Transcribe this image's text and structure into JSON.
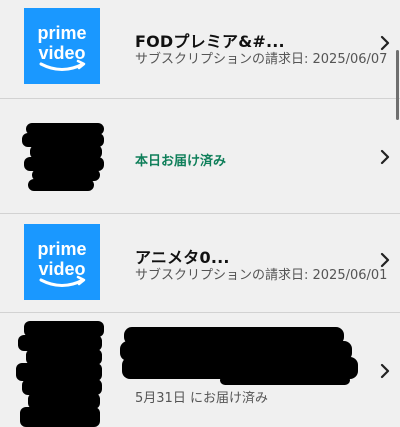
{
  "orders": [
    {
      "thumbnail": "prime-video-logo",
      "logo_line1": "prime",
      "logo_line2": "video",
      "title": "FODプレミア&#...",
      "subtitle": "サブスクリプションの請求日: 2025/06/07"
    },
    {
      "thumbnail": "redacted-image",
      "status": "本日お届け済み",
      "status_color": "#0f7f5a"
    },
    {
      "thumbnail": "prime-video-logo",
      "logo_line1": "prime",
      "logo_line2": "video",
      "title": "アニメタ0...",
      "subtitle": "サブスクリプションの請求日: 2025/06/01"
    },
    {
      "thumbnail": "redacted-image",
      "title_redacted": true,
      "status": "5月31日 にお届け済み"
    }
  ],
  "colors": {
    "background": "#f0f0f0",
    "prime_video_blue": "#1a98ff",
    "delivered_green": "#0f7f5a",
    "redaction": "#000000"
  },
  "icons": {
    "row_chevron": "chevron-right-icon",
    "logo_smile": "amazon-smile-icon"
  }
}
